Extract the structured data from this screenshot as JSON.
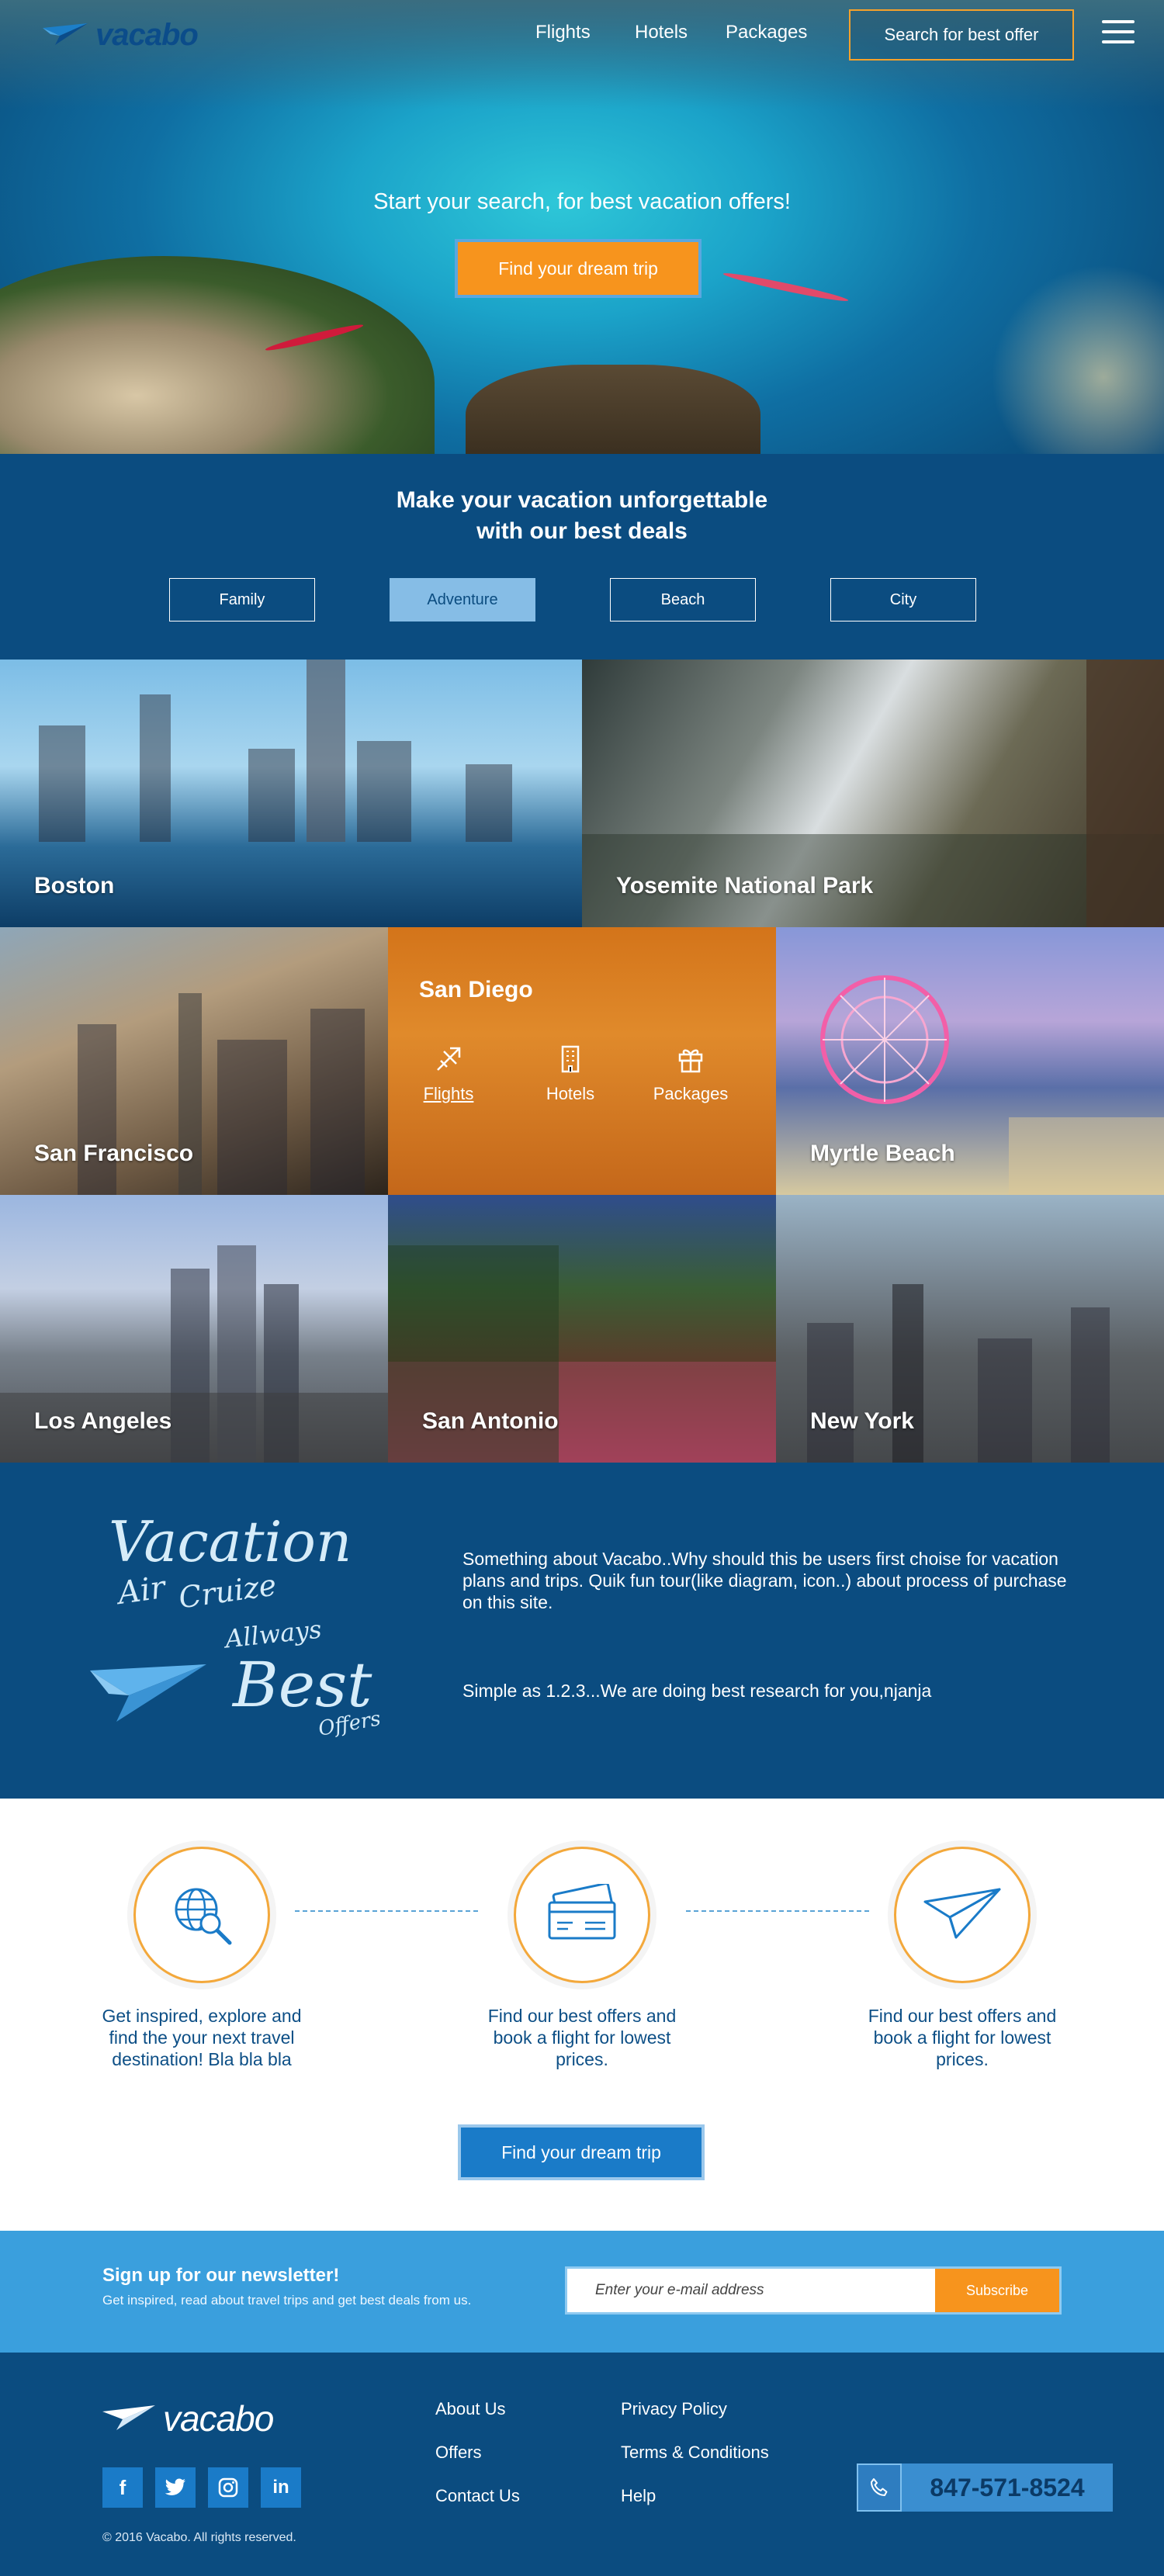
{
  "brand": {
    "name": "vacabo"
  },
  "nav": {
    "flights": "Flights",
    "hotels": "Hotels",
    "packages": "Packages",
    "search_button": "Search for best offer"
  },
  "hero": {
    "tagline": "Start your search, for best vacation offers!",
    "cta": "Find your dream trip"
  },
  "deals": {
    "title_line1": "Make your vacation unforgettable",
    "title_line2": "with our best deals",
    "categories": [
      "Family",
      "Adventure",
      "Beach",
      "City"
    ],
    "active_category": "Adventure"
  },
  "destinations": [
    {
      "name": "Boston"
    },
    {
      "name": "Yosemite National Park"
    },
    {
      "name": "San Francisco"
    },
    {
      "name": "San Diego",
      "options": [
        "Flights",
        "Hotels",
        "Packages"
      ]
    },
    {
      "name": "Myrtle Beach"
    },
    {
      "name": "Los Angeles"
    },
    {
      "name": "San Antonio"
    },
    {
      "name": "New York"
    }
  ],
  "about": {
    "slogan": {
      "w1": "Vacation",
      "w2": "Air",
      "w3": "Cruize",
      "w4": "Allways",
      "w5": "Best",
      "w6": "Offers"
    },
    "paragraph1": "Something about Vacabo..Why should this be users first choise for vacation plans and trips. Quik fun tour(like diagram, icon..) about process of purchase on this site.",
    "paragraph2": "Simple as 1.2.3...We are doing best research for you,njanja"
  },
  "steps": {
    "items": [
      {
        "text": "Get inspired, explore and find the your next travel destination! Bla bla bla",
        "icon": "globe-search-icon"
      },
      {
        "text": "Find our best offers and book a flight for lowest prices.",
        "icon": "ticket-icon"
      },
      {
        "text": "Find our best offers and book a flight for lowest prices.",
        "icon": "paper-plane-icon"
      }
    ],
    "cta": "Find your dream trip"
  },
  "newsletter": {
    "title": "Sign up for our newsletter!",
    "subtitle": "Get inspired, read about travel trips and get best deals from us.",
    "placeholder": "Enter your e-mail address",
    "button": "Subscribe"
  },
  "footer": {
    "brand": "vacabo",
    "links_col1": [
      "About Us",
      "Offers",
      "Contact Us"
    ],
    "links_col2": [
      "Privacy Policy",
      "Terms & Conditions",
      "Help"
    ],
    "social": [
      "f",
      "t",
      "ig",
      "in"
    ],
    "copyright": "© 2016 Vacabo. All rights reserved.",
    "phone": "847-571-8524"
  },
  "colors": {
    "primary_dark": "#0b4c80",
    "accent_orange": "#f7941d",
    "accent_blue": "#3a9fdd",
    "button_blue": "#1a7bc8"
  }
}
